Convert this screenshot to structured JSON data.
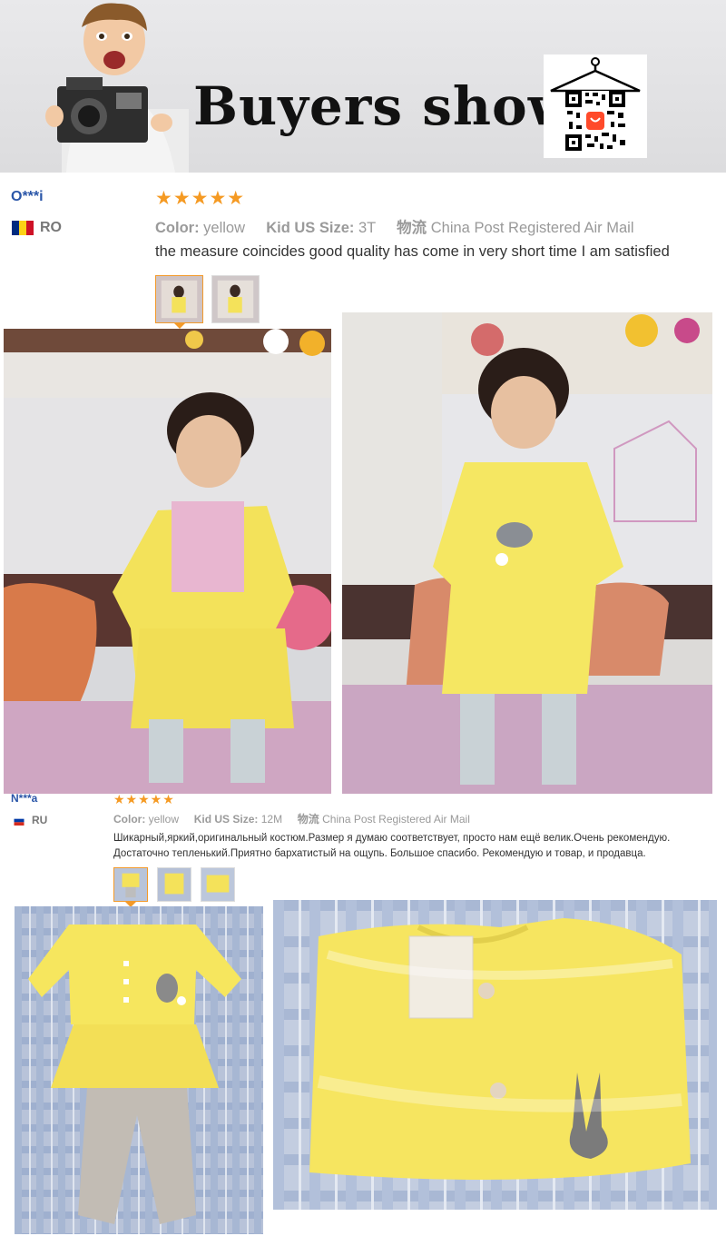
{
  "banner": {
    "title": "Buyers show",
    "brand_colors": {
      "title": "#111111",
      "qr_hanger": "#000000",
      "qr_logo": "#ff4a2a"
    }
  },
  "reviews": [
    {
      "buyer": "O***i",
      "country_code": "RO",
      "rating": "★★★★★",
      "color_label": "Color:",
      "color_value": "yellow",
      "size_label": "Kid US Size:",
      "size_value": "3T",
      "shipping_label": "物流",
      "shipping_value": "China Post Registered Air Mail",
      "text": "the measure coincides good quality has come in very short time I am satisfied"
    },
    {
      "buyer": "N***a",
      "country_code": "RU",
      "rating": "★★★★★",
      "color_label": "Color:",
      "color_value": "yellow",
      "size_label": "Kid US Size:",
      "size_value": "12M",
      "shipping_label": "物流",
      "shipping_value": "China Post Registered Air Mail",
      "text_line1": "Шикарный,яркий,оригинальный костюм.Размер я думаю соответствует, просто нам ещё велик.Очень рекомендую.",
      "text_line2": "Достаточно тепленький.Приятно бархатистый на ощупь. Большое спасибо. Рекомендую и товар, и продавца."
    }
  ],
  "colors": {
    "accent_star": "#f59a23",
    "buyer_name": "#2a56a8",
    "active_thumb": "#f39a2a",
    "garment_yellow": "#f4e25a"
  }
}
